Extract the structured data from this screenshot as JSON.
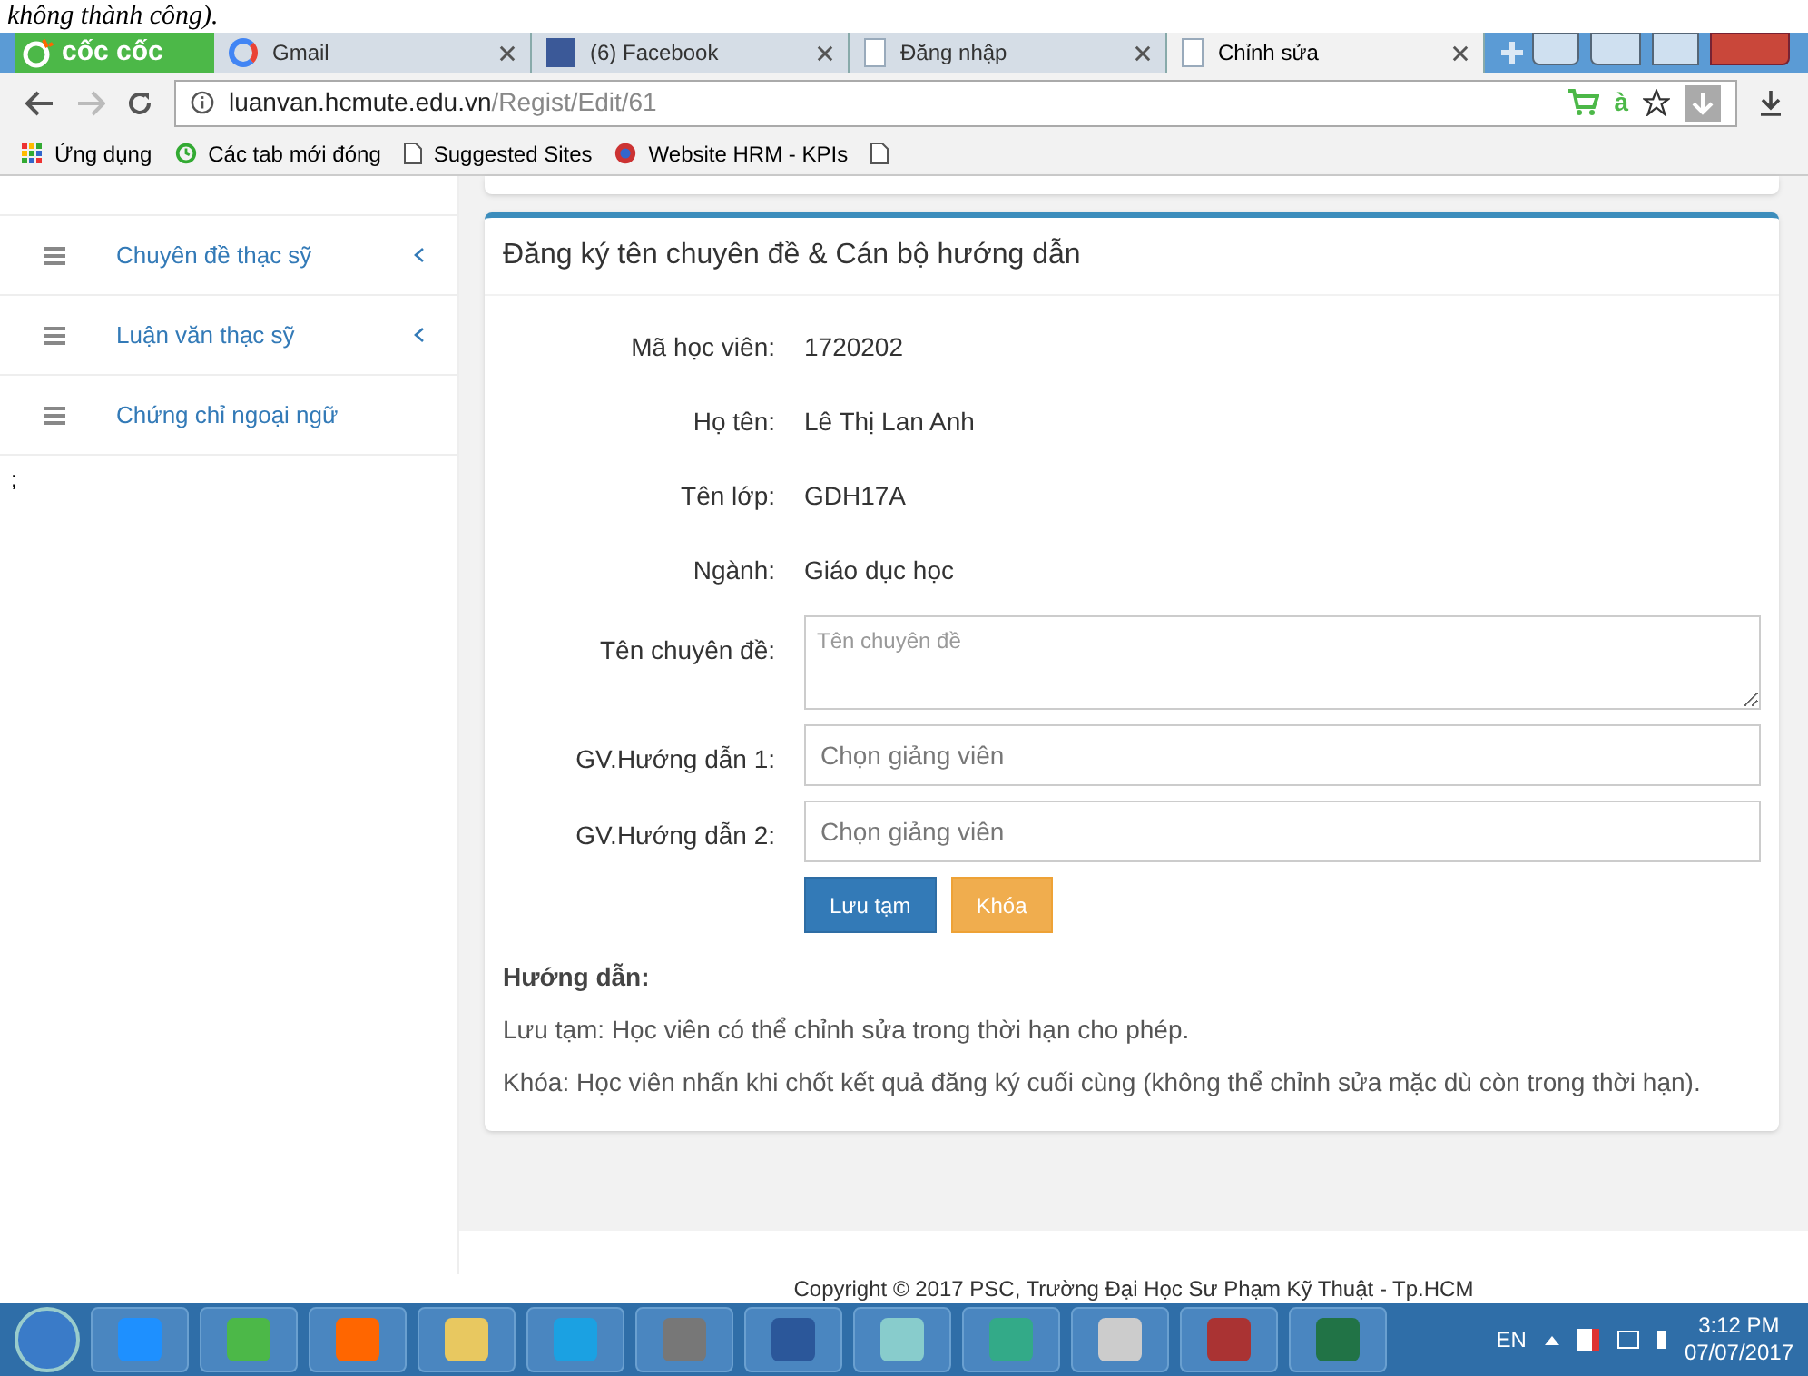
{
  "caption": "không thành công).",
  "browser": {
    "brand": "cốc cốc",
    "tabs": [
      {
        "title": "Gmail",
        "kind": "g",
        "selected": false
      },
      {
        "title": "(6) Facebook",
        "kind": "f",
        "selected": false
      },
      {
        "title": "Đăng nhập",
        "kind": "doc",
        "selected": false
      },
      {
        "title": "Chỉnh sửa",
        "kind": "doc",
        "selected": true
      }
    ],
    "url_host": "luanvan.hcmute.edu.vn",
    "url_path": "/Regist/Edit/61",
    "addon_letter": "à",
    "bookmarks": [
      {
        "label": "Ứng dụng",
        "kind": "apps"
      },
      {
        "label": "Các tab mới đóng",
        "kind": "history"
      },
      {
        "label": "Suggested Sites",
        "kind": "page"
      },
      {
        "label": "Website HRM - KPIs",
        "kind": "globe"
      },
      {
        "kind": "page"
      }
    ]
  },
  "sidebar": {
    "items": [
      {
        "label": "Chuyên đề thạc sỹ",
        "expandable": true
      },
      {
        "label": "Luận văn thạc sỹ",
        "expandable": true
      },
      {
        "label": "Chứng chỉ ngoại ngữ",
        "expandable": false
      }
    ],
    "stray": ";"
  },
  "form": {
    "title": "Đăng ký tên chuyên đề & Cán bộ hướng dẫn",
    "fields": [
      {
        "label": "Mã học viên:",
        "kind": "text",
        "value": "1720202"
      },
      {
        "label": "Họ tên:",
        "kind": "text",
        "value": "Lê Thị Lan Anh"
      },
      {
        "label": "Tên lớp:",
        "kind": "text",
        "value": "GDH17A"
      },
      {
        "label": "Ngành:",
        "kind": "text",
        "value": "Giáo dục học"
      },
      {
        "label": "Tên chuyên đề:",
        "kind": "textarea",
        "placeholder": "Tên chuyên đề"
      },
      {
        "label": "GV.Hướng dẫn 1:",
        "kind": "select",
        "placeholder": "Chọn giảng viên"
      },
      {
        "label": "GV.Hướng dẫn 2:",
        "kind": "select",
        "placeholder": "Chọn giảng viên"
      }
    ],
    "buttons": [
      {
        "label": "Lưu tạm",
        "kind": "primary"
      },
      {
        "label": "Khóa",
        "kind": "warning"
      }
    ],
    "help_title": "Hướng dẫn:",
    "help": [
      "Lưu tạm: Học viên có thể chỉnh sửa trong thời hạn cho phép.",
      "Khóa: Học viên nhấn khi chốt kết quả đăng ký cuối cùng (không thể chỉnh sửa mặc dù còn trong thời hạn)."
    ]
  },
  "footer": "Copyright © 2017 PSC, Trường Đại Học Sư Phạm Kỹ Thuật - Tp.HCM",
  "taskbar": {
    "language": "EN",
    "time": "3:12 PM",
    "date": "07/07/2017"
  }
}
